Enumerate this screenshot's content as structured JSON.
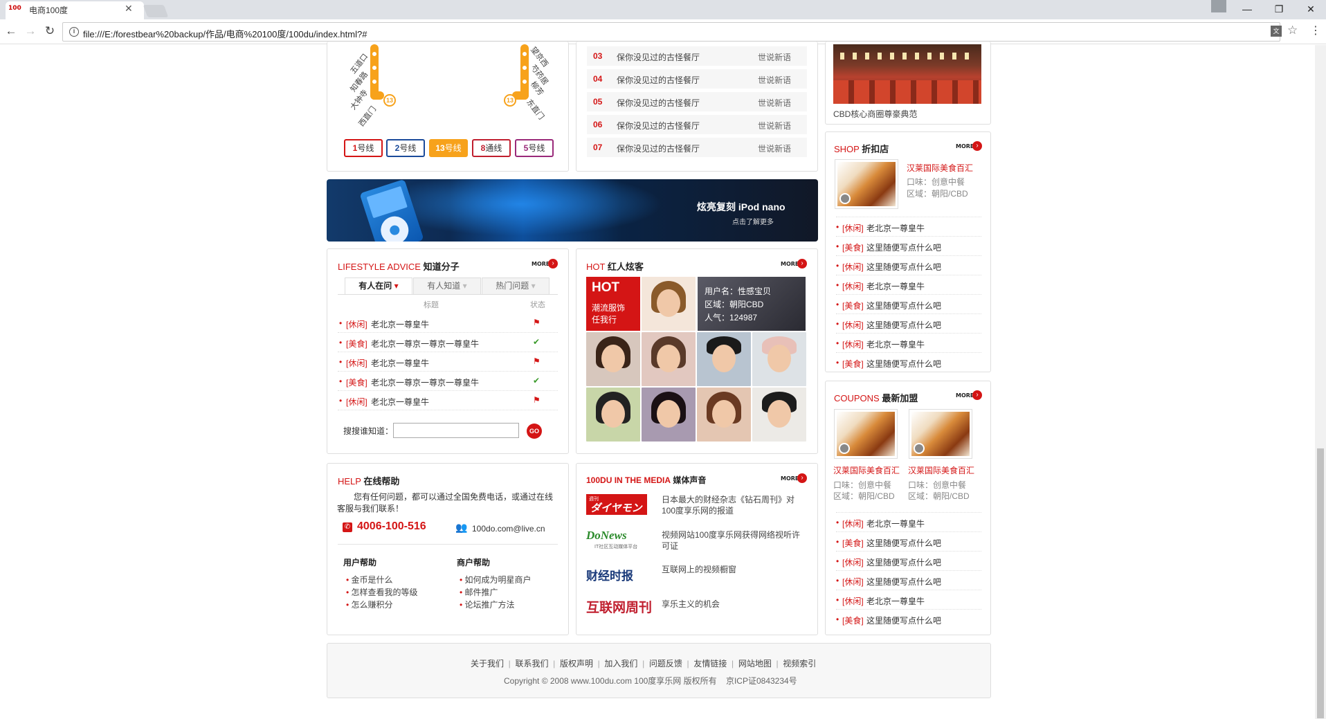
{
  "browser": {
    "tab_title": "电商100度",
    "tab_favicon": "100",
    "url": "file:///E:/forestbear%20backup/作品/电商%20100度/100du/index.html?#",
    "icons": [
      "back-icon",
      "forward-icon",
      "reload-icon",
      "info-icon",
      "translate-icon",
      "star-icon",
      "menu-icon",
      "minimize-icon",
      "maximize-icon",
      "close-icon",
      "profile-icon"
    ]
  },
  "metro": {
    "left_stations": [
      "五道口",
      "知春路",
      "大钟寺",
      "西直门"
    ],
    "right_stations": [
      "望京西",
      "芍药居",
      "柳芳",
      "东直门"
    ],
    "line_number": "13",
    "buttons": [
      {
        "num": "1",
        "label": "号线",
        "color": "#d41515"
      },
      {
        "num": "2",
        "label": "号线",
        "color": "#1a4a9a"
      },
      {
        "num": "13",
        "label": "号线",
        "color": "#f7a21b"
      },
      {
        "num": "8",
        "label": "通线",
        "color": "#c01e2e"
      },
      {
        "num": "5",
        "label": "号线",
        "color": "#9a2a7a"
      }
    ]
  },
  "rank_list": [
    {
      "num": "03",
      "title": "保你没见过的古怪餐厅",
      "source": "世说新语"
    },
    {
      "num": "04",
      "title": "保你没见过的古怪餐厅",
      "source": "世说新语"
    },
    {
      "num": "05",
      "title": "保你没见过的古怪餐厅",
      "source": "世说新语"
    },
    {
      "num": "06",
      "title": "保你没见过的古怪餐厅",
      "source": "世说新语"
    },
    {
      "num": "07",
      "title": "保你没见过的古怪餐厅",
      "source": "世说新语"
    }
  ],
  "cbd": {
    "caption": "CBD核心商圈尊豪典范"
  },
  "banner": {
    "text": "炫亮复刻  iPod nano",
    "sub": "点击了解更多"
  },
  "lifestyle": {
    "title_en": "LIFESTYLE ADVICE",
    "title_cn": "知道分子",
    "more": "MORE",
    "tabs": [
      "有人在问",
      "有人知道",
      "热门问题"
    ],
    "col_title": "标题",
    "col_status": "状态",
    "rows": [
      {
        "tag": "[休闲]",
        "text": "老北京一尊皇牛",
        "status": "flag"
      },
      {
        "tag": "[美食]",
        "text": "老北京一尊京一尊京一尊皇牛",
        "status": "check"
      },
      {
        "tag": "[休闲]",
        "text": "老北京一尊皇牛",
        "status": "flag"
      },
      {
        "tag": "[美食]",
        "text": "老北京一尊京一尊京一尊皇牛",
        "status": "check"
      },
      {
        "tag": "[休闲]",
        "text": "老北京一尊皇牛",
        "status": "flag"
      }
    ],
    "search_label": "搜搜谁知道：",
    "search_value": "",
    "go_label": "GO"
  },
  "hot": {
    "title_en": "HOT",
    "title_cn": "红人炫客",
    "more": "MORE",
    "badge_big": "HOT",
    "badge_line1": "潮流服饰",
    "badge_line2": "任我行",
    "user_name": "用户名：性感宝贝",
    "user_area": "区域：朝阳CBD",
    "user_pop": "人气：124987"
  },
  "shop": {
    "title_en": "SHOP",
    "title_cn": "折扣店",
    "more": "MORE",
    "feature_name": "汉莱国际美食百汇",
    "feature_taste": "口味：创意中餐",
    "feature_area": "区域：朝阳/CBD",
    "rows": [
      {
        "tag": "[休闲]",
        "text": "老北京一尊皇牛"
      },
      {
        "tag": "[美食]",
        "text": "这里随便写点什么吧"
      },
      {
        "tag": "[休闲]",
        "text": "这里随便写点什么吧"
      },
      {
        "tag": "[休闲]",
        "text": "老北京一尊皇牛"
      },
      {
        "tag": "[美食]",
        "text": "这里随便写点什么吧"
      },
      {
        "tag": "[休闲]",
        "text": "这里随便写点什么吧"
      },
      {
        "tag": "[休闲]",
        "text": "老北京一尊皇牛"
      },
      {
        "tag": "[美食]",
        "text": "这里随便写点什么吧"
      }
    ]
  },
  "coupons": {
    "title_en": "COUPONS",
    "title_cn": "最新加盟",
    "more": "MORE",
    "items": [
      {
        "name": "汉莱国际美食百汇",
        "taste": "口味：创意中餐",
        "area": "区域：朝阳/CBD"
      },
      {
        "name": "汉莱国际美食百汇",
        "taste": "口味：创意中餐",
        "area": "区域：朝阳/CBD"
      }
    ],
    "rows": [
      {
        "tag": "[休闲]",
        "text": "老北京一尊皇牛"
      },
      {
        "tag": "[美食]",
        "text": "这里随便写点什么吧"
      },
      {
        "tag": "[休闲]",
        "text": "这里随便写点什么吧"
      },
      {
        "tag": "[休闲]",
        "text": "这里随便写点什么吧"
      },
      {
        "tag": "[休闲]",
        "text": "老北京一尊皇牛"
      },
      {
        "tag": "[美食]",
        "text": "这里随便写点什么吧"
      }
    ]
  },
  "help": {
    "title_en": "HELP",
    "title_cn": "在线帮助",
    "intro": "您有任何问题，都可以通过全国免费电话，或通过在线客服与我们联系！",
    "phone": "4006-100-516",
    "email": "100do.com@live.cn",
    "user_help_title": "用户帮助",
    "user_help": [
      "金币是什么",
      "怎样查看我的等级",
      "怎么赚积分"
    ],
    "merchant_help_title": "商户帮助",
    "merchant_help": [
      "如何成为明星商户",
      "邮件推广",
      "论坛推广方法"
    ]
  },
  "media": {
    "title_en": "100DU IN THE MEDIA",
    "title_cn": "媒体声音",
    "more": "MORE",
    "items": [
      {
        "logo": "ダイヤモンド",
        "logo_sub": "週刊",
        "text": "日本最大的财经杂志《钻石周刊》对100度享乐网的报道"
      },
      {
        "logo": "DoNews",
        "logo_sub": "IT社区互动媒体平台",
        "text": "视频网站100度享乐网获得网络视听许可证"
      },
      {
        "logo": "财经时报",
        "logo_sub": "",
        "text": "互联网上的视频橱窗"
      },
      {
        "logo": "互联网周刊",
        "logo_sub": "",
        "text": "享乐主义的机会"
      }
    ]
  },
  "footer": {
    "links": [
      "关于我们",
      "联系我们",
      "版权声明",
      "加入我们",
      "问题反馈",
      "友情链接",
      "网站地图",
      "视频索引"
    ],
    "copyright": "Copyright © 2008 www.100du.com 100度享乐网 版权所有    京ICP证0843234号"
  }
}
